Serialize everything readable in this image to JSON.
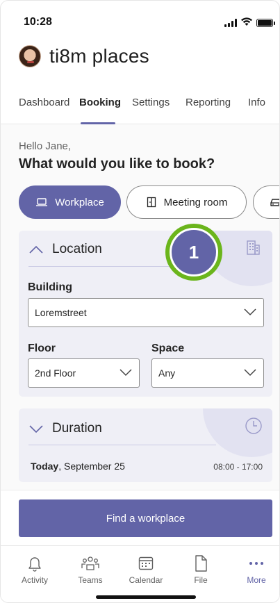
{
  "status": {
    "time": "10:28"
  },
  "app": {
    "title": "ti8m places"
  },
  "tabs": [
    {
      "label": "Dashboard"
    },
    {
      "label": "Booking"
    },
    {
      "label": "Settings"
    },
    {
      "label": "Reporting"
    },
    {
      "label": "Info"
    }
  ],
  "greeting": "Hello Jane,",
  "question": "What would you like to book?",
  "chips": [
    {
      "label": "Workplace",
      "icon": "laptop-icon"
    },
    {
      "label": "Meeting room",
      "icon": "door-icon"
    },
    {
      "label": "",
      "icon": "car-icon"
    }
  ],
  "location": {
    "title": "Location",
    "building_label": "Building",
    "building_value": "Loremstreet",
    "floor_label": "Floor",
    "floor_value": "2nd Floor",
    "space_label": "Space",
    "space_value": "Any"
  },
  "marker": {
    "number": "1"
  },
  "duration": {
    "title": "Duration",
    "day": "Today",
    "date": ", September 25",
    "hours": "08:00 - 17:00"
  },
  "cta": {
    "label": "Find a workplace"
  },
  "nav": [
    {
      "label": "Activity",
      "icon": "bell-icon"
    },
    {
      "label": "Teams",
      "icon": "teams-icon"
    },
    {
      "label": "Calendar",
      "icon": "calendar-icon"
    },
    {
      "label": "File",
      "icon": "file-icon"
    },
    {
      "label": "More",
      "icon": "more-icon"
    }
  ],
  "colors": {
    "accent": "#6264a7",
    "marker_ring": "#6bb51c",
    "card": "#efeff6"
  }
}
